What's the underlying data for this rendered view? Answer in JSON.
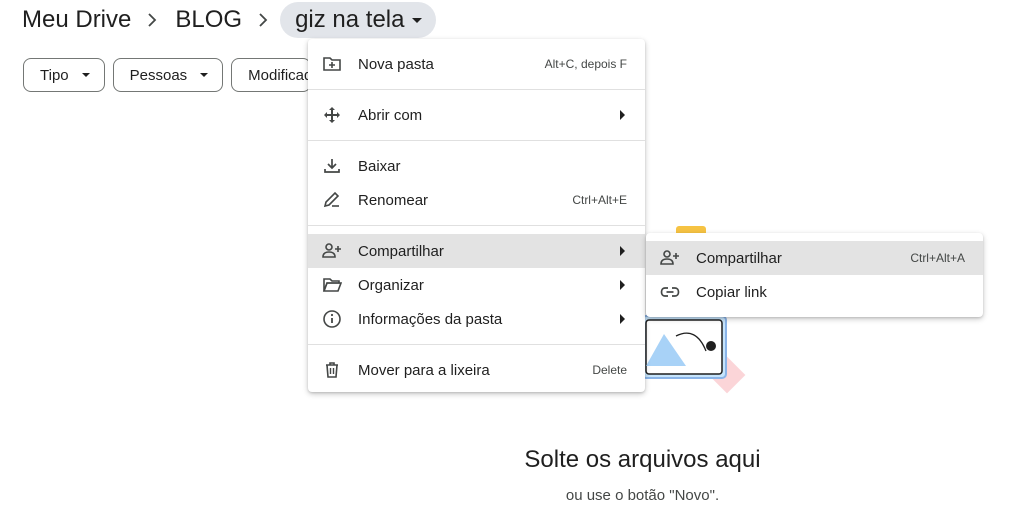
{
  "breadcrumb": {
    "items": [
      "Meu Drive",
      "BLOG"
    ],
    "current": "giz na tela"
  },
  "filters": [
    {
      "label": "Tipo"
    },
    {
      "label": "Pessoas"
    },
    {
      "label": "Modificado"
    }
  ],
  "context_menu": {
    "nova_pasta": {
      "label": "Nova pasta",
      "shortcut": "Alt+C, depois F",
      "icon": "new-folder-icon"
    },
    "abrir_com": {
      "label": "Abrir com",
      "icon": "open-with-icon"
    },
    "baixar": {
      "label": "Baixar",
      "icon": "download-icon"
    },
    "renomear": {
      "label": "Renomear",
      "shortcut": "Ctrl+Alt+E",
      "icon": "rename-icon"
    },
    "compartilhar": {
      "label": "Compartilhar",
      "icon": "share-person-icon"
    },
    "organizar": {
      "label": "Organizar",
      "icon": "folder-open-icon"
    },
    "informacoes": {
      "label": "Informações da pasta",
      "icon": "info-icon"
    },
    "lixeira": {
      "label": "Mover para a lixeira",
      "shortcut": "Delete",
      "icon": "trash-icon"
    }
  },
  "submenu": {
    "compartilhar": {
      "label": "Compartilhar",
      "shortcut": "Ctrl+Alt+A",
      "icon": "share-person-icon"
    },
    "copiar_link": {
      "label": "Copiar link",
      "icon": "link-icon"
    }
  },
  "empty_state": {
    "title": "Solte os arquivos aqui",
    "subtitle": "ou use o botão \"Novo\"."
  },
  "colors": {
    "highlight": "#e3e3e3",
    "chip_border": "#747775",
    "current_crumb_bg": "#e2e5ea"
  }
}
